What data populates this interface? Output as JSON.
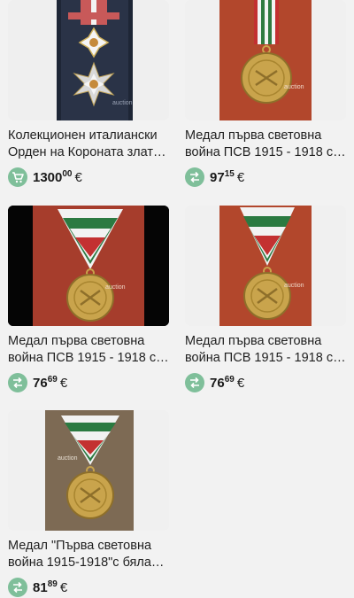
{
  "items": [
    {
      "title": "Колекционен италиански Орден на Короната злат…",
      "price_int": "1300",
      "price_frac": "00",
      "currency": "€",
      "icon": "cart-icon"
    },
    {
      "title": "Медал първа световна война ПСВ 1915 - 1918 с…",
      "price_int": "97",
      "price_frac": "15",
      "currency": "€",
      "icon": "swap-icon"
    },
    {
      "title": "Медал първа световна война ПСВ 1915 - 1918 с…",
      "price_int": "76",
      "price_frac": "69",
      "currency": "€",
      "icon": "swap-icon"
    },
    {
      "title": "Медал първа световна война ПСВ 1915 - 1918 с…",
      "price_int": "76",
      "price_frac": "69",
      "currency": "€",
      "icon": "swap-icon"
    },
    {
      "title": "Медал \"Първа световна война 1915-1918\"с бяла…",
      "price_int": "81",
      "price_frac": "89",
      "currency": "€",
      "icon": "swap-icon"
    }
  ],
  "colors": {
    "icon_bg": "#7fbf9a",
    "text": "#1f1f1f"
  }
}
